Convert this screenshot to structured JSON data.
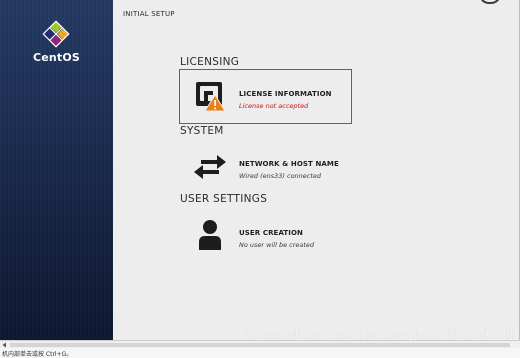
{
  "app": {
    "sidebar": {
      "logo_text": "CentOS",
      "logo_icon": "centos-logo"
    },
    "header": {
      "title": "INITIAL SETUP"
    },
    "sections": {
      "licensing": {
        "title": "LICENSING",
        "spoke": {
          "label": "LICENSE INFORMATION",
          "status": "License not accepted",
          "icon": "license-warning-icon"
        }
      },
      "system": {
        "title": "SYSTEM",
        "spoke": {
          "label": "NETWORK & HOST NAME",
          "status": "Wired (ens33) connected",
          "icon": "network-arrows-icon"
        }
      },
      "user_settings": {
        "title": "USER SETTINGS",
        "spoke": {
          "label": "USER CREATION",
          "status": "No user will be created",
          "icon": "user-icon"
        }
      }
    },
    "status_bar": {
      "hint": "机内部单击或按 Ctrl+G。"
    },
    "watermark": "https://blog.csdn.net/weixin_45019231",
    "colors": {
      "sidebar_bg": "#1c2e52",
      "error_text": "#c4161c",
      "highlight_border": "#e22d2d",
      "warning": "#f07d12"
    }
  }
}
